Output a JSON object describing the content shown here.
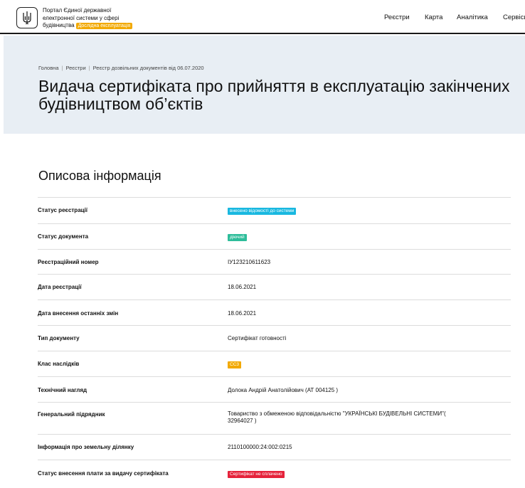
{
  "header": {
    "brand_line1": "Портал Єдиної державної",
    "brand_line2": "електронної системи у сфері",
    "brand_line3": "будівництва",
    "trial_badge": "Дослідна експлуатація",
    "nav": [
      {
        "label": "Реєстри"
      },
      {
        "label": "Карта"
      },
      {
        "label": "Аналітика"
      },
      {
        "label": "Сервіси"
      }
    ]
  },
  "breadcrumb": {
    "items": [
      "Головна",
      "Реєстри",
      "Реєстр дозвільних документів від 06.07.2020"
    ]
  },
  "page": {
    "title_line1": "Видача сертифіката про прийняття в експлуатацію закінчених",
    "title_line2": "будівництвом об’єктів",
    "section_title": "Описова інформація"
  },
  "colors": {
    "cyan": "#19b8e0",
    "green": "#2ebd9a",
    "orange": "#f2a900",
    "red": "#e5233b"
  },
  "rows": [
    {
      "label": "Статус реєстрації",
      "value": "внесено відомості до системи",
      "tag": "cyan"
    },
    {
      "label": "Статус документа",
      "value": "діючий",
      "tag": "green"
    },
    {
      "label": "Реєстраційний номер",
      "value": "ІУ123210611623"
    },
    {
      "label": "Дата реєстрації",
      "value": "18.06.2021"
    },
    {
      "label": "Дата внесення останніх змін",
      "value": "18.06.2021"
    },
    {
      "label": "Тип документу",
      "value": "Сертифікат готовності"
    },
    {
      "label": "Клас наслідків",
      "value": "СС3",
      "tag": "orange"
    },
    {
      "label": "Технічний нагляд",
      "value": "Долока Андрій Анатолійович (АТ 004125 )"
    },
    {
      "label": "Генеральний підрядник",
      "value": "Товариство з обмеженою відповідальністю \"УКРАЇНСЬКІ БУДІВЕЛЬНІ СИСТЕМИ\"(",
      "value2": "32964027 )"
    },
    {
      "label": "Інформація про земельну ділянку",
      "value": "2110100000:24:002:0215"
    },
    {
      "label": "Статус внесення плати за видачу сертифіката",
      "value": "Сертифікат не сплачено",
      "tag": "red"
    }
  ]
}
